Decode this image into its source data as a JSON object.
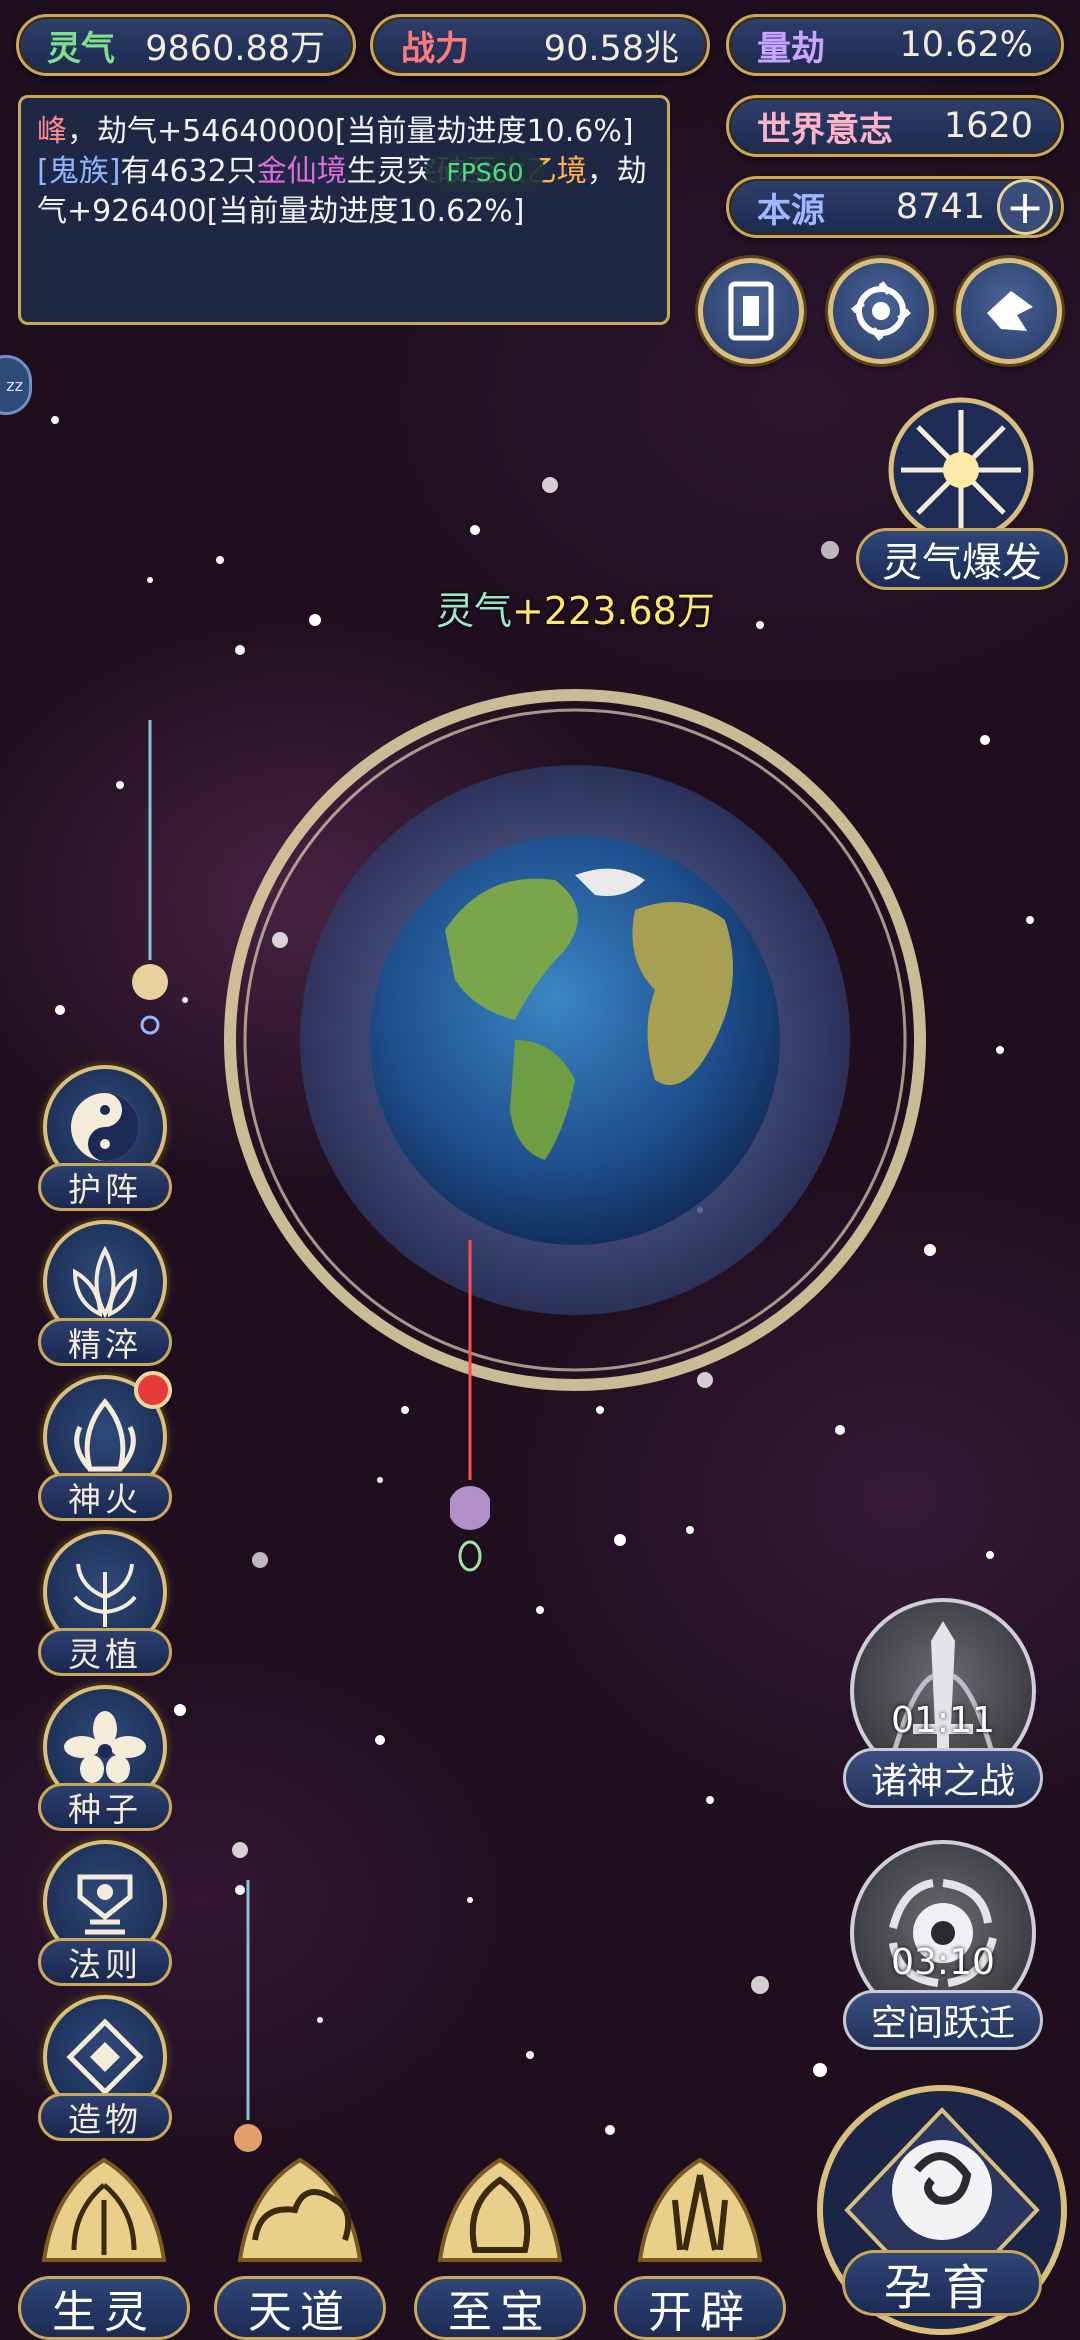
{
  "hud": {
    "lingqi": {
      "label": "灵气",
      "value": "9860.88万"
    },
    "zhanli": {
      "label": "战力",
      "value": "90.58兆"
    },
    "liangjie": {
      "label": "量劫",
      "value": "10.62%"
    },
    "shijie": {
      "label": "世界意志",
      "value": "1620"
    },
    "benyuan": {
      "label": "本源",
      "value": "8741",
      "plus": "+"
    }
  },
  "log": {
    "line1_a": "峰",
    "line1_b": "，劫气+54640000[当前量劫进度10.6%]",
    "line2_tag": "[鬼族]",
    "line2_a": "有4632只",
    "line2_realm1": "金仙境",
    "line2_b": "生灵突破至",
    "line2_realm2": "太乙境",
    "line2_c": "，劫气+926400[当前量劫进度10.62%]"
  },
  "fps": "FPS60",
  "side_tab_label": "zz",
  "float_gain": {
    "label": "灵气",
    "value": "+223.68万"
  },
  "burst_button": "灵气爆发",
  "left_menu": [
    {
      "label": "护阵",
      "icon": "yin-yang-icon"
    },
    {
      "label": "精淬",
      "icon": "lotus-flame-icon"
    },
    {
      "label": "神火",
      "icon": "divine-fire-icon",
      "badge": true
    },
    {
      "label": "灵植",
      "icon": "spirit-plant-icon"
    },
    {
      "label": "种子",
      "icon": "seed-flower-icon"
    },
    {
      "label": "法则",
      "icon": "law-rune-icon"
    },
    {
      "label": "造物",
      "icon": "creation-diamond-icon"
    }
  ],
  "events": [
    {
      "label": "诸神之战",
      "timer": "01:11",
      "icon": "sword-icon"
    },
    {
      "label": "空间跃迁",
      "timer": "03:10",
      "icon": "vortex-icon"
    }
  ],
  "bottom_bar": [
    {
      "label": "生灵",
      "icon": "creature-emblem-icon"
    },
    {
      "label": "天道",
      "icon": "heaven-cloud-icon"
    },
    {
      "label": "至宝",
      "icon": "treasure-emblem-icon"
    },
    {
      "label": "开辟",
      "icon": "flame-emblem-icon"
    }
  ],
  "nurture_button": "孕育",
  "colors": {
    "gold": "#c9a85a",
    "panel": "#1c2a4e",
    "lingqi": "#7de08a",
    "zhanli": "#ff7a7a",
    "gain": "#ffe968"
  }
}
